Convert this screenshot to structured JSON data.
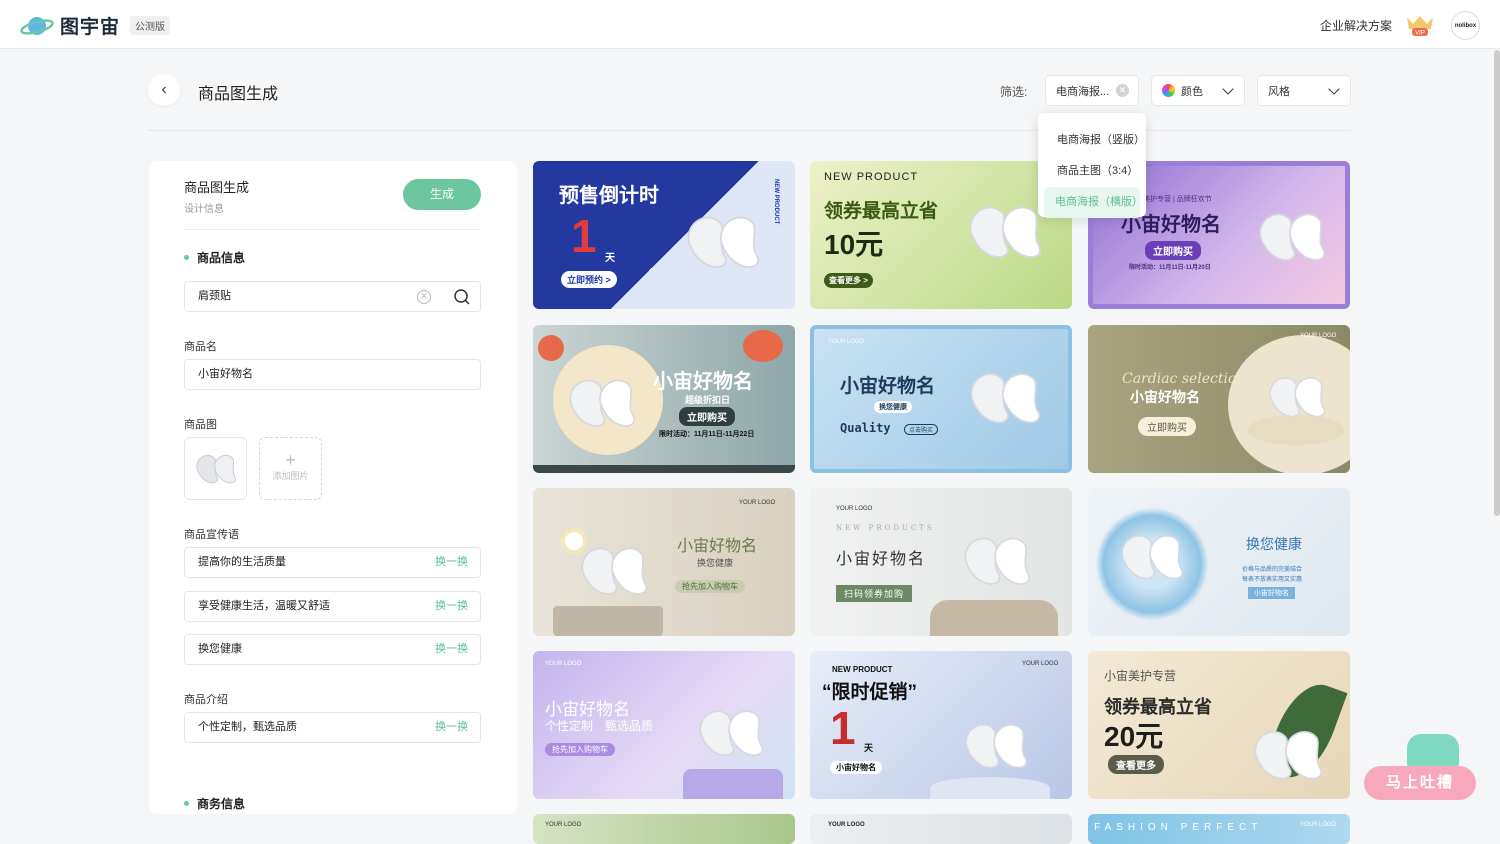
{
  "topbar": {
    "logo_text": "图宇宙",
    "beta_badge": "公测版",
    "enterprise_link": "企业解决方案",
    "vip_label": "VIP",
    "avatar_text": "nolibox"
  },
  "header": {
    "title": "商品图生成",
    "filter_label": "筛选:",
    "filters": [
      {
        "value": "电商海报...",
        "kind": "clearable"
      },
      {
        "value": "颜色",
        "kind": "color"
      },
      {
        "value": "风格",
        "kind": "select"
      }
    ],
    "dropdown_options": [
      {
        "label": "电商海报（竖版）",
        "active": false
      },
      {
        "label": "商品主图（3:4）",
        "active": false
      },
      {
        "label": "电商海报（横版）",
        "active": true
      }
    ]
  },
  "panel": {
    "title": "商品图生成",
    "subtitle": "设计信息",
    "generate_label": "生成",
    "section_product": "商品信息",
    "search_value": "肩颈贴",
    "name_label": "商品名",
    "name_value": "小宙好物名",
    "image_label": "商品图",
    "add_image_label": "添加图片",
    "slogan_label": "商品宣传语",
    "slogans": [
      "提高你的生活质量",
      "享受健康生活，温暖又舒适",
      "换您健康"
    ],
    "swap_label": "换一换",
    "intro_label": "商品介绍",
    "intro_value": "个性定制，甄选品质",
    "section_business": "商务信息"
  },
  "cards": [
    {
      "lines": [
        "预售倒计时",
        "1",
        "天",
        "立即预约 >",
        "NEW PRODUCT"
      ]
    },
    {
      "lines": [
        "NEW PRODUCT",
        "领券最高立省",
        "10元",
        "查看更多 >"
      ]
    },
    {
      "lines": [
        "美护专营 | 品牌狂欢节",
        "小宙好物名",
        "立即购买",
        "限时活动：11月11日-11月20日"
      ]
    },
    {
      "lines": [
        "小宙好物名",
        "超级折扣日",
        "立即购买",
        "限时活动：11月11日-11月22日"
      ]
    },
    {
      "lines": [
        "小宙好物名",
        "换您健康",
        "Quality",
        "点击购买",
        "YOUR LOGO"
      ]
    },
    {
      "lines": [
        "Cardiac selection",
        "小宙好物名",
        "立即购买",
        "YOUR LOGO"
      ]
    },
    {
      "lines": [
        "小宙好物名",
        "换您健康",
        "抢先加入购物车",
        "YOUR LOGO"
      ]
    },
    {
      "lines": [
        "NEW PRODUCTS",
        "小宙好物名",
        "扫码领券加购",
        "YOUR LOGO"
      ]
    },
    {
      "lines": [
        "换您健康",
        "价格与品质的完美结合",
        "每表不放表实用又实惠",
        "小宙好物名"
      ]
    },
    {
      "lines": [
        "小宙好物名",
        "个性定制　甄选品质",
        "抢先加入购物车",
        "YOUR LOGO"
      ]
    },
    {
      "lines": [
        "NEW PRODUCT",
        "“限时促销”",
        "1",
        "天",
        "小宙好物名",
        "YOUR LOGO"
      ]
    },
    {
      "lines": [
        "小宙美护专营",
        "领券最高立省",
        "20元",
        "查看更多"
      ]
    },
    {
      "lines": [
        "YOUR LOGO"
      ]
    },
    {
      "lines": [
        "YOUR LOGO"
      ]
    },
    {
      "lines": [
        "FASHION PERFECT",
        "YOUR LOGO"
      ]
    }
  ],
  "feedback_label": "马上吐槽",
  "colors": {
    "accent": "#6cc7a1",
    "accent_text": "#5bbf96"
  }
}
